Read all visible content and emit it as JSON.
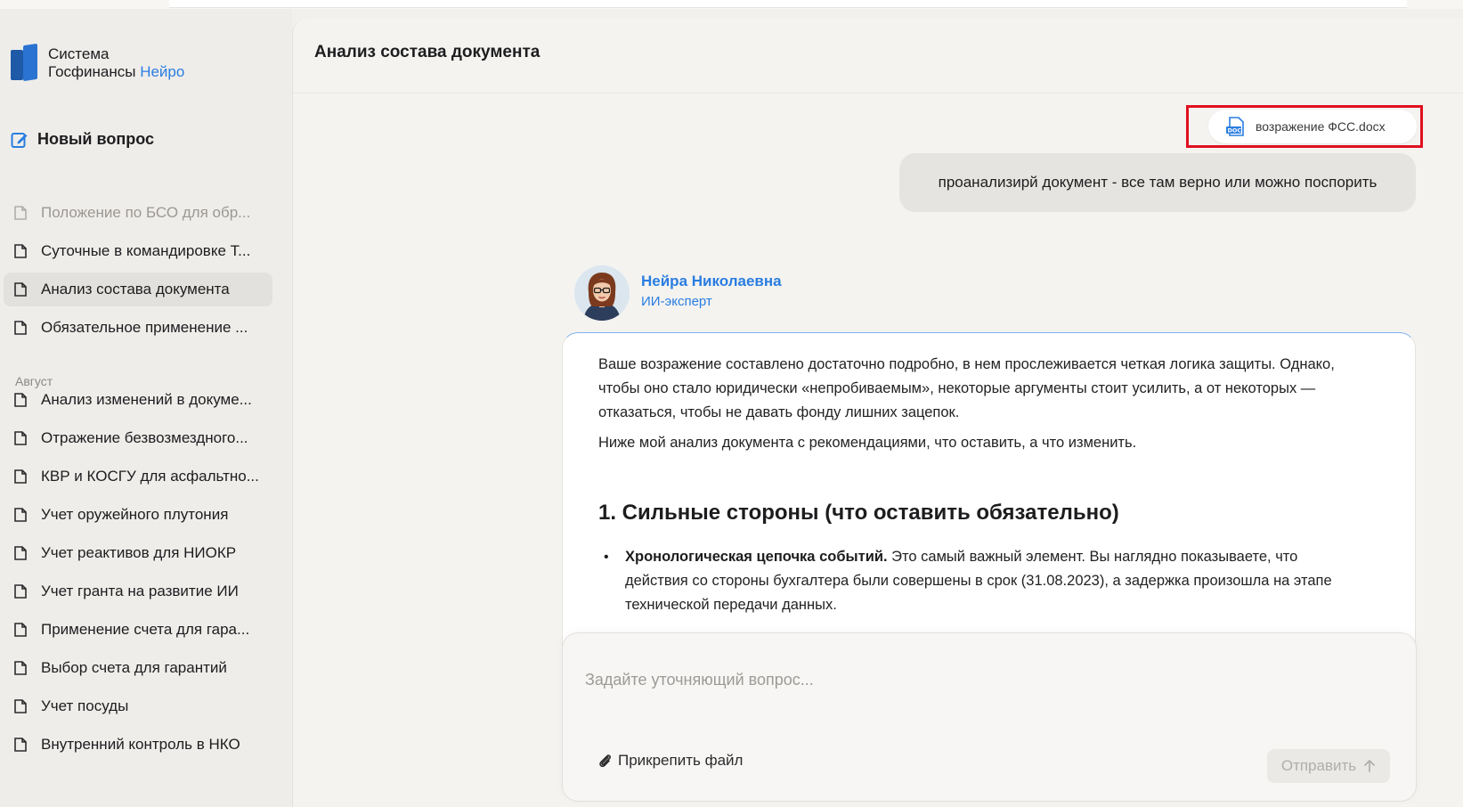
{
  "brand": {
    "line1": "Система",
    "line2": "Госфинансы",
    "accent": "Нейро",
    "accent_color": "#2a7de1"
  },
  "sidebar": {
    "new_question": "Новый вопрос",
    "items": [
      {
        "label": "Положение по БСО для обр...",
        "icon": "document-icon"
      },
      {
        "label": "Суточные в командировке Т...",
        "icon": "document-icon"
      },
      {
        "label": "Анализ состава документа",
        "icon": "document-icon"
      },
      {
        "label": "Обязательное применение ...",
        "icon": "document-icon"
      }
    ],
    "month_label": "Август",
    "august_items": [
      {
        "label": "Анализ изменений в докуме...",
        "icon": "document-icon"
      },
      {
        "label": "Отражение безвозмездного...",
        "icon": "document-icon"
      },
      {
        "label": "КВР и КОСГУ для асфальтно...",
        "icon": "document-icon"
      },
      {
        "label": "Учет оружейного плутония",
        "icon": "document-icon"
      },
      {
        "label": "Учет реактивов для НИОКР",
        "icon": "document-icon"
      },
      {
        "label": "Учет гранта на развитие ИИ",
        "icon": "document-icon"
      },
      {
        "label": "Применение счета для гара...",
        "icon": "document-icon"
      },
      {
        "label": "Выбор счета для гарантий",
        "icon": "document-icon"
      },
      {
        "label": "Учет посуды",
        "icon": "document-icon"
      },
      {
        "label": "Внутренний контроль в НКО",
        "icon": "document-icon"
      }
    ]
  },
  "main": {
    "title": "Анализ состава документа",
    "attachment": {
      "filename": "возражение ФСС.docx",
      "icon": "docx-file-icon",
      "highlight_color": "#e0101f"
    },
    "user_message": "проанализирй документ - все там верно или можно поспорить",
    "assistant": {
      "name": "Нейра Николаевна",
      "role": "ИИ-эксперт",
      "paragraphs": [
        "Ваше возражение составлено достаточно подробно, в нем прослеживается четкая логика защиты. Однако, чтобы оно стало юридически «непробиваемым», некоторые аргументы стоит усилить, а от некоторых — отказаться, чтобы не давать фонду лишних зацепок.",
        "Ниже мой анализ документа с рекомендациями, что оставить, а что изменить."
      ],
      "heading": "1. Сильные стороны (что оставить обязательно)",
      "bullet_bold": "Хронологическая цепочка событий.",
      "bullet_text": " Это самый важный элемент. Вы наглядно показываете, что действия со стороны бухгалтера были совершены в срок (31.08.2023), а задержка произошла на этапе технической передачи данных."
    },
    "composer": {
      "placeholder": "Задайте уточняющий вопрос...",
      "attach_label": "Прикрепить файл",
      "send_label": "Отправить"
    }
  }
}
